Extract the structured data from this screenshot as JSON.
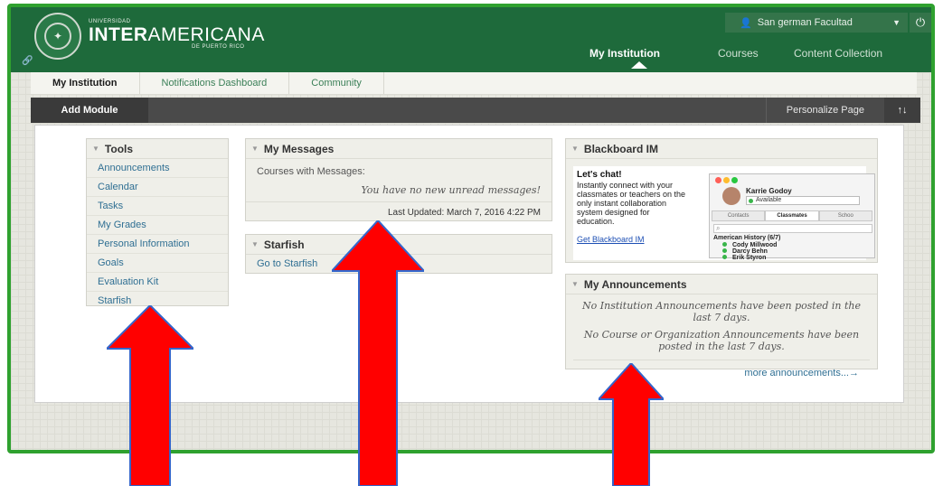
{
  "logo": {
    "small_text": "UNIVERSIDAD",
    "main_bold": "INTER",
    "main_light": "AMERICANA",
    "sub_text": "DE PUERTO RICO"
  },
  "user": {
    "name": "San german Facultad"
  },
  "top_nav": [
    {
      "label": "My Institution"
    },
    {
      "label": "Courses"
    },
    {
      "label": "Content Collection"
    }
  ],
  "sub_tabs": [
    {
      "label": "My Institution"
    },
    {
      "label": "Notifications Dashboard"
    },
    {
      "label": "Community"
    }
  ],
  "module_bar": {
    "add_module": "Add Module",
    "personalize": "Personalize Page",
    "sort_icon": "↑↓"
  },
  "tools": {
    "title": "Tools",
    "items": [
      "Announcements",
      "Calendar",
      "Tasks",
      "My Grades",
      "Personal Information",
      "Goals",
      "Evaluation Kit",
      "Starfish"
    ]
  },
  "messages": {
    "title": "My Messages",
    "courses_label": "Courses with Messages:",
    "none_text": "You have no new unread messages!",
    "last_updated": "Last Updated: March 7, 2016 4:22 PM"
  },
  "starfish": {
    "title": "Starfish",
    "link": "Go to Starfish"
  },
  "blackboard_im": {
    "title": "Blackboard IM",
    "chat_title": "Let's chat!",
    "chat_text": "Instantly connect with your classmates or teachers on the only instant collaboration system designed for education.",
    "link": "Get Blackboard IM",
    "contact_name": "Karrie Godoy",
    "status": "Available",
    "tabs": [
      "Contacts",
      "Classmates",
      "Schoo"
    ],
    "group": "American History (6/7)",
    "contacts": [
      "Cody Millwood",
      "Darcy Behn",
      "Erik Styron"
    ]
  },
  "announcements": {
    "title": "My Announcements",
    "institution_text": "No Institution Announcements have been posted in the last 7 days.",
    "course_text": "No Course or Organization Announcements have been posted in the last 7 days.",
    "more_link": "more announcements...→"
  },
  "colors": {
    "header_green": "#1e6a3b",
    "border_green": "#2fa12f",
    "arrow_red": "#ff0000",
    "link_blue": "#2f6f93"
  }
}
